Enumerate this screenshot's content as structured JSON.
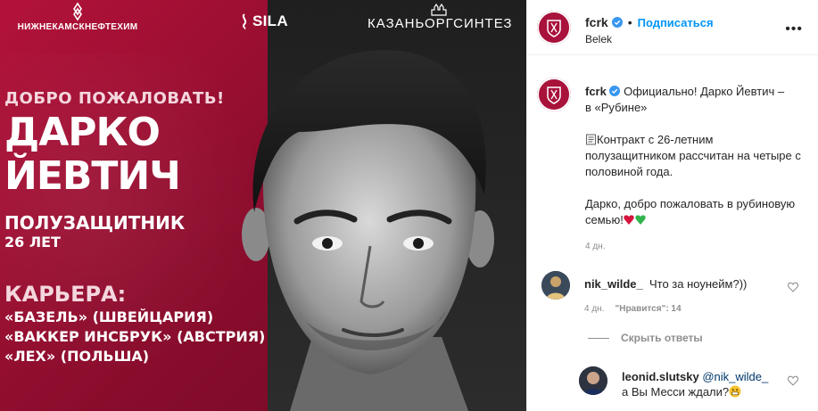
{
  "media": {
    "sponsors": {
      "first": "НИЖНЕКАМСКНЕФТЕХИМ",
      "second": "SILA",
      "third": "КАЗАНЬОРГСИНТЕЗ"
    },
    "welcome": "ДОБРО ПОЖАЛОВАТЬ!",
    "first_name": "ДАРКО",
    "last_name": "ЙЕВТИЧ",
    "position": "ПОЛУЗАЩИТНИК",
    "age": "26 ЛЕТ",
    "career_title": "КАРЬЕРА:",
    "career": [
      "«БАЗЕЛЬ» (ШВЕЙЦАРИЯ)",
      "«ВАККЕР ИНСБРУК» (АВСТРИЯ)",
      "«ЛЕХ» (ПОЛЬША)"
    ],
    "colors": {
      "brand": "#a8123b"
    }
  },
  "header": {
    "username": "fcrk",
    "dot": "•",
    "follow_label": "Подписаться",
    "location": "Belek",
    "more_icon": "more-horizontal-icon"
  },
  "caption": {
    "username": "fcrk",
    "line1": "Официально! Дарко Йевтич –",
    "line2": "в «Рубине»",
    "contract": "Контракт с 26-летним полузащитником рассчитан на четыре с половиной года.",
    "welcome": "Дарко, добро пожаловать в рубиновую семью!",
    "time": "4 дн."
  },
  "comments": [
    {
      "username": "nik_wilde_",
      "text": "Что за ноунейм?))",
      "time": "4 дн.",
      "likes": "\"Нравится\": 14",
      "show_replies": "Скрыть ответы"
    },
    {
      "username": "leonid.slutsky",
      "mention": "@nik_wilde_",
      "text": "а Вы Месси ждали?"
    }
  ]
}
